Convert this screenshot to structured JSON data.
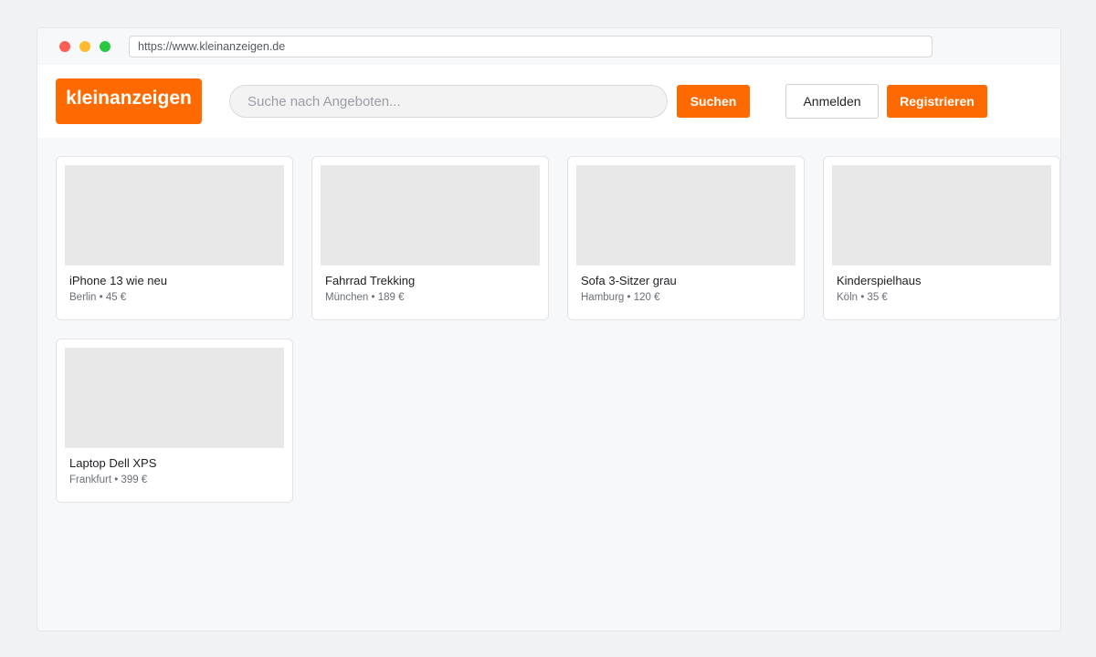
{
  "browser": {
    "url": "https://www.kleinanzeigen.de"
  },
  "header": {
    "logo": "kleinanzeigen",
    "search_placeholder": "Suche nach Angeboten...",
    "search_button": "Suchen",
    "login_button": "Anmelden",
    "register_button": "Registrieren"
  },
  "colors": {
    "brand": "#ff6a00",
    "background": "#f7f8fa"
  },
  "listings": [
    {
      "title": "iPhone 13 wie neu",
      "location": "Berlin",
      "price": "45 €",
      "meta": "Berlin • 45 €"
    },
    {
      "title": "Fahrrad Trekking",
      "location": "München",
      "price": "189 €",
      "meta": "München • 189 €"
    },
    {
      "title": "Sofa 3-Sitzer grau",
      "location": "Hamburg",
      "price": "120 €",
      "meta": "Hamburg • 120 €"
    },
    {
      "title": "Kinderspielhaus",
      "location": "Köln",
      "price": "35 €",
      "meta": "Köln • 35 €"
    },
    {
      "title": "Laptop Dell XPS",
      "location": "Frankfurt",
      "price": "399 €",
      "meta": "Frankfurt • 399 €"
    }
  ]
}
